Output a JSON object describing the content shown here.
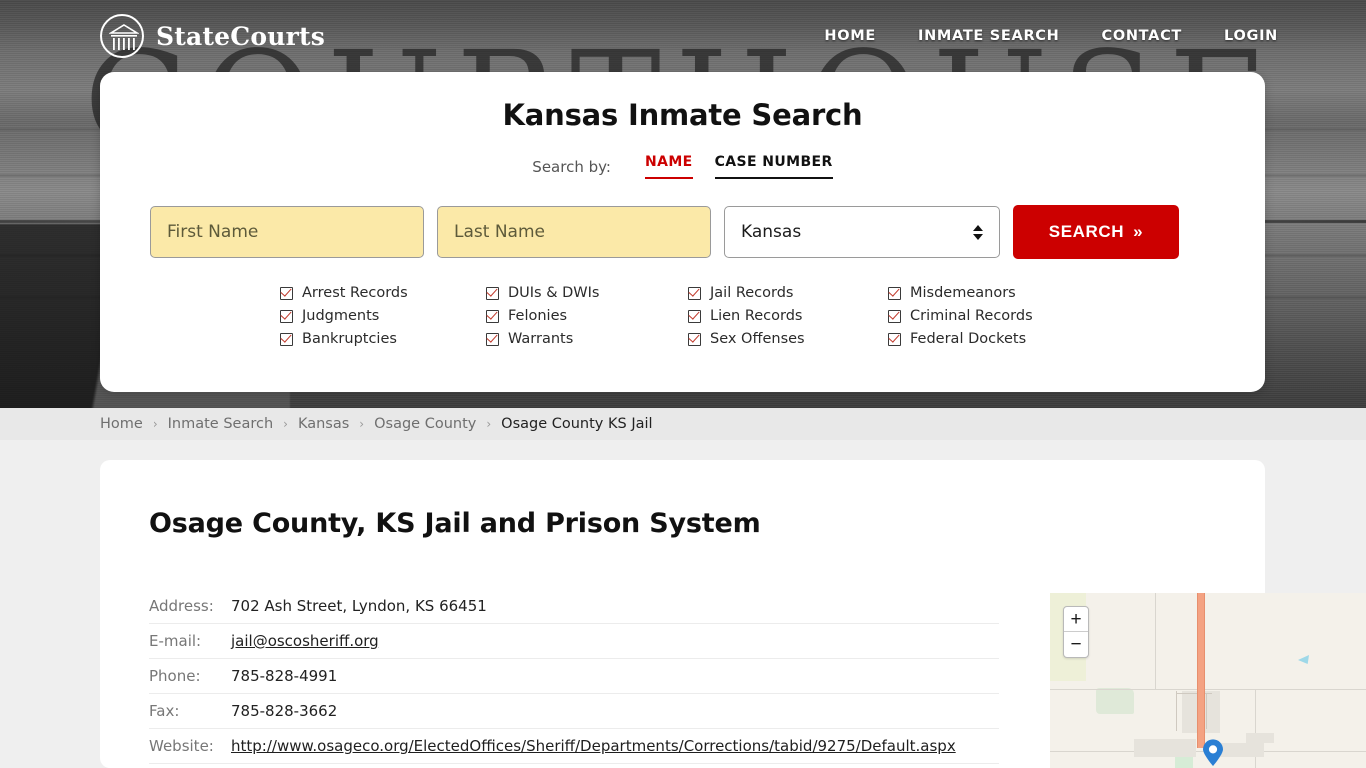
{
  "header": {
    "brand": "StateCourts",
    "logo_icon": "courthouse-icon",
    "hero_word": "COURTHOUSE",
    "nav": [
      {
        "label": "HOME"
      },
      {
        "label": "INMATE SEARCH"
      },
      {
        "label": "CONTACT"
      },
      {
        "label": "LOGIN"
      }
    ]
  },
  "search_card": {
    "title": "Kansas Inmate Search",
    "search_by_label": "Search by:",
    "tabs": [
      {
        "label": "NAME",
        "active": true
      },
      {
        "label": "CASE NUMBER",
        "active": false
      }
    ],
    "first_name": {
      "value": "",
      "placeholder": "First Name"
    },
    "last_name": {
      "value": "",
      "placeholder": "Last Name"
    },
    "state_select": {
      "value": "Kansas"
    },
    "search_button": "SEARCH",
    "search_button_chevron": "»",
    "accent_red": "#cc0000",
    "input_fill": "#fbe9a8",
    "checks": [
      "Arrest Records",
      "DUIs & DWIs",
      "Jail Records",
      "Misdemeanors",
      "Judgments",
      "Felonies",
      "Lien Records",
      "Criminal Records",
      "Bankruptcies",
      "Warrants",
      "Sex Offenses",
      "Federal Dockets"
    ]
  },
  "breadcrumb": {
    "separator": "›",
    "items": [
      {
        "label": "Home",
        "current": false
      },
      {
        "label": "Inmate Search",
        "current": false
      },
      {
        "label": "Kansas",
        "current": false
      },
      {
        "label": "Osage County",
        "current": false
      },
      {
        "label": "Osage County KS Jail",
        "current": true
      }
    ]
  },
  "main": {
    "page_title": "Osage County, KS Jail and Prison System",
    "info_rows": [
      {
        "key": "Address:",
        "value": "702 Ash Street, Lyndon, KS 66451",
        "link": false
      },
      {
        "key": "E-mail:",
        "value": "jail@oscosheriff.org",
        "link": true
      },
      {
        "key": "Phone:",
        "value": "785-828-4991",
        "link": false
      },
      {
        "key": "Fax:",
        "value": "785-828-3662",
        "link": false
      },
      {
        "key": "Website:",
        "value": "http://www.osageco.org/ElectedOffices/Sheriff/Departments/Corrections/tabid/9275/Default.aspx",
        "link": true
      }
    ]
  },
  "map": {
    "zoom_in": "+",
    "zoom_out": "−",
    "marker_color": "#2a7fd4",
    "highway_color": "#f4a282"
  }
}
